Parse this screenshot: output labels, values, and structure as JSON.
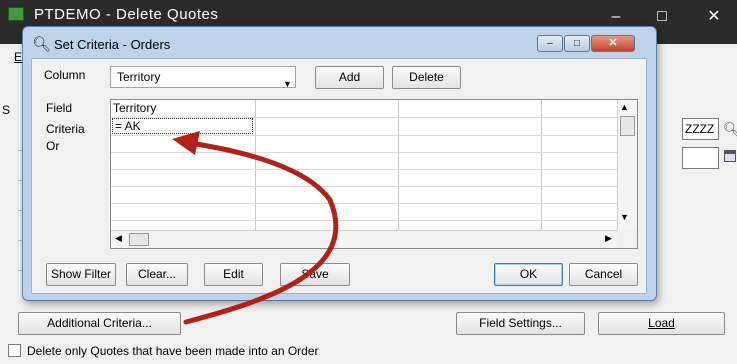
{
  "background_window": {
    "title": "PTDEMO - Delete Quotes",
    "menu_letter": "E",
    "side_letter": "S",
    "controls": {
      "minimize": "–",
      "maximize": "□",
      "close": "✕"
    },
    "field_value": "ZZZZ",
    "buttons": {
      "additional_criteria": "Additional Criteria...",
      "field_settings": "Field Settings...",
      "load": "Load"
    },
    "checkbox_label": "Delete only Quotes that have been made into an Order"
  },
  "dialog": {
    "title": "Set Criteria - Orders",
    "controls": {
      "minimize": "–",
      "maximize": "□",
      "close": "✕"
    },
    "column_label": "Column",
    "column_selected": "Territory",
    "add_label": "Add",
    "delete_label": "Delete",
    "row_labels": {
      "field": "Field",
      "criteria": "Criteria",
      "or": "Or"
    },
    "grid": {
      "header": "Territory",
      "criteria_value": "= AK"
    },
    "buttons": {
      "show_filter": "Show Filter",
      "clear": "Clear...",
      "edit": "Edit",
      "save": "Save",
      "ok": "OK",
      "cancel": "Cancel"
    }
  },
  "annotation": {
    "arrow_color": "#b32015"
  }
}
